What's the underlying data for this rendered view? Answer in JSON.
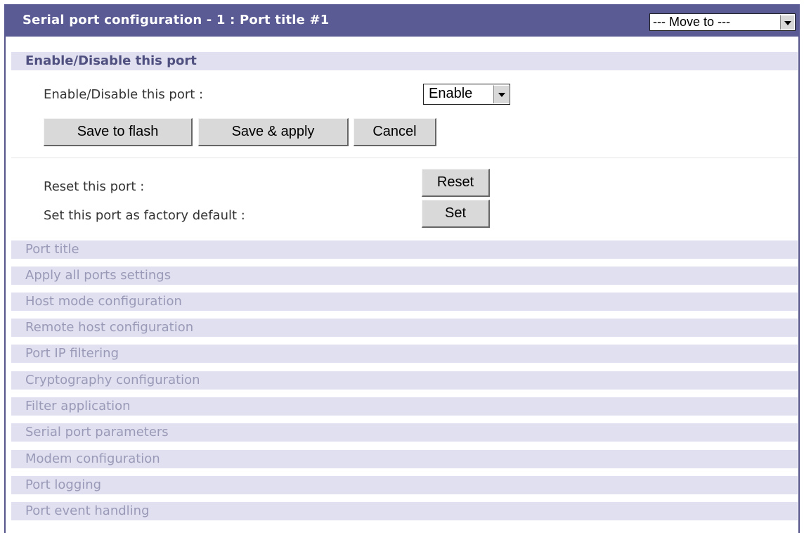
{
  "header": {
    "title": "Serial port configuration - 1 : Port title #1",
    "move_to": "--- Move to ---"
  },
  "enable_section": {
    "heading": "Enable/Disable this port",
    "field_label": "Enable/Disable this port :",
    "field_value": "Enable",
    "save_flash": "Save to flash",
    "save_apply": "Save & apply",
    "cancel": "Cancel"
  },
  "reset_section": {
    "reset_label": "Reset this port :",
    "reset_button": "Reset",
    "factory_label": "Set this port as factory default :",
    "factory_button": "Set"
  },
  "sections": [
    "Port title",
    "Apply all ports settings",
    "Host mode configuration",
    "Remote host configuration",
    "Port IP filtering",
    "Cryptography configuration",
    "Filter application",
    "Serial port parameters",
    "Modem configuration",
    "Port logging",
    "Port event handling"
  ]
}
